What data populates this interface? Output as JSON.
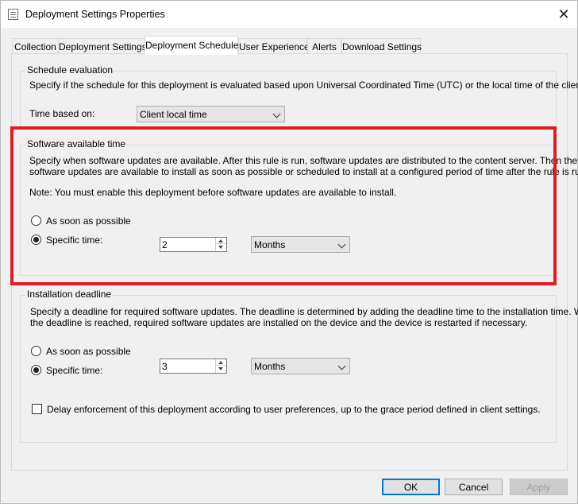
{
  "window": {
    "title": "Deployment Settings Properties",
    "close_glyph": "✕"
  },
  "tabs": [
    {
      "label": "Collection"
    },
    {
      "label": "Deployment Settings"
    },
    {
      "label": "Deployment Schedule",
      "active": true
    },
    {
      "label": "User Experience"
    },
    {
      "label": "Alerts"
    },
    {
      "label": "Download Settings"
    }
  ],
  "schedule_evaluation": {
    "title": "Schedule evaluation",
    "description": "Specify if the schedule for this deployment is evaluated based upon Universal Coordinated Time (UTC) or the local time of the client.",
    "time_based_on_label": "Time based on:",
    "time_based_on_value": "Client local time"
  },
  "software_available_time": {
    "title": "Software available time",
    "description_line1": "Specify when software updates are available. After this rule is run, software updates are distributed to the content server. Then the",
    "description_line2": "software updates are available to install as soon as possible or scheduled to install at a configured period of time after the rule is run.",
    "note": "Note: You must enable this deployment before software updates are available to install.",
    "asap_label": "As soon as possible",
    "specific_label": "Specific time:",
    "selected": "specific",
    "amount": "2",
    "unit": "Months"
  },
  "installation_deadline": {
    "title": "Installation deadline",
    "description_line1": "Specify a deadline for required software updates. The deadline is determined by adding the deadline time to the installation time. When",
    "description_line2": "the deadline is reached, required software updates are installed on the device and the device is restarted if necessary.",
    "asap_label": "As soon as possible",
    "specific_label": "Specific time:",
    "selected": "specific",
    "amount": "3",
    "unit": "Months",
    "delay_label": "Delay enforcement of this deployment according to user preferences, up to the grace period defined in client settings.",
    "delay_checked": false
  },
  "buttons": {
    "ok": "OK",
    "cancel": "Cancel",
    "apply": "Apply"
  },
  "colors": {
    "highlight": "#e11b22",
    "default_button_border": "#0078d7"
  }
}
